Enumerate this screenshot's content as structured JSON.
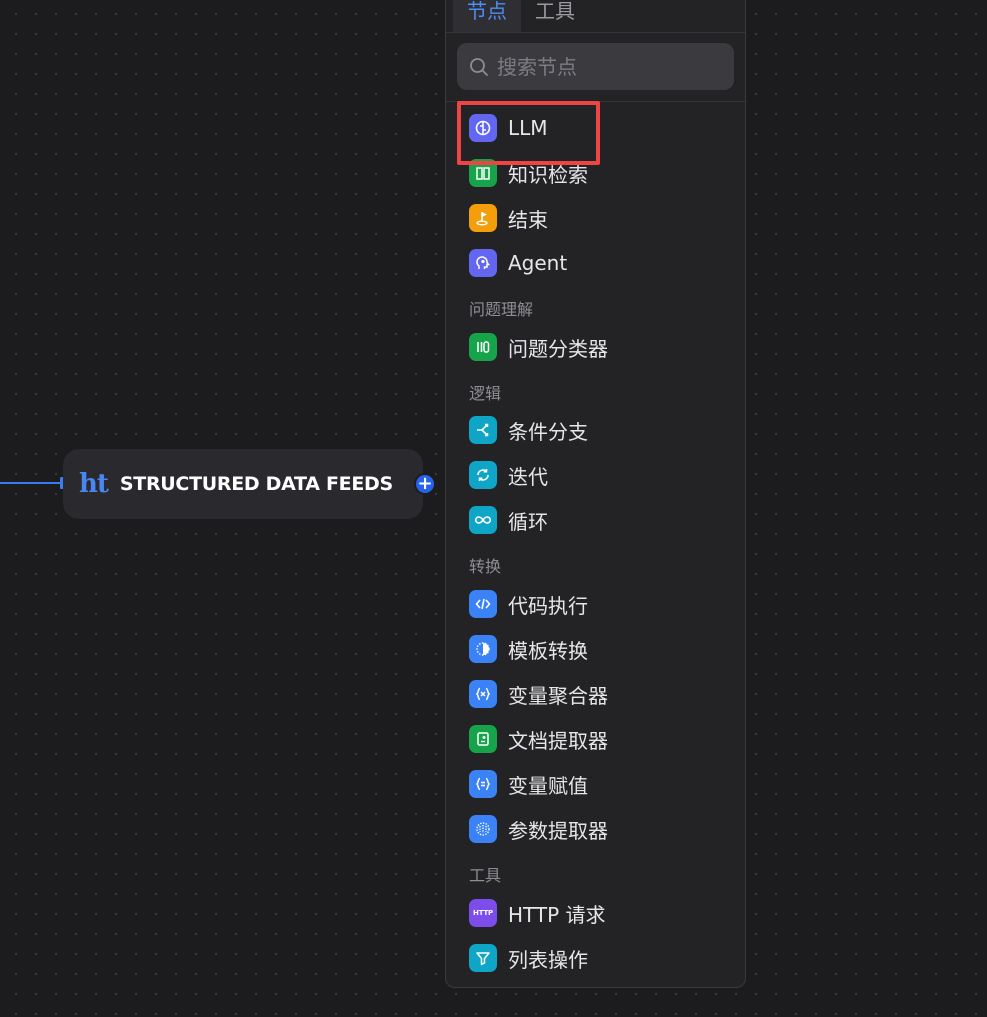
{
  "node": {
    "logo_text": "ht",
    "title": "STRUCTURED DATA FEEDS",
    "add_symbol": "+"
  },
  "panel": {
    "tabs": [
      {
        "label": "节点",
        "active": true
      },
      {
        "label": "工具",
        "active": false
      }
    ],
    "search": {
      "placeholder": "搜索节点",
      "value": ""
    },
    "items": [
      {
        "label": "LLM",
        "icon": "brain-icon",
        "color": "#6366f1"
      },
      {
        "label": "知识检索",
        "icon": "book-icon",
        "color": "#16a34a"
      },
      {
        "label": "结束",
        "icon": "flag-icon",
        "color": "#f59e0b"
      },
      {
        "label": "Agent",
        "icon": "agent-head-icon",
        "color": "#6366f1"
      },
      {
        "label": "问题分类器",
        "icon": "classifier-icon",
        "color": "#16a34a"
      },
      {
        "label": "条件分支",
        "icon": "branch-icon",
        "color": "#0ea5c6"
      },
      {
        "label": "迭代",
        "icon": "iteration-icon",
        "color": "#0ea5c6"
      },
      {
        "label": "循环",
        "icon": "infinity-icon",
        "color": "#0ea5c6"
      },
      {
        "label": "代码执行",
        "icon": "code-icon",
        "color": "#3b82f6"
      },
      {
        "label": "模板转换",
        "icon": "template-icon",
        "color": "#3b82f6"
      },
      {
        "label": "变量聚合器",
        "icon": "variable-aggregator-icon",
        "color": "#3b82f6"
      },
      {
        "label": "文档提取器",
        "icon": "document-icon",
        "color": "#16a34a"
      },
      {
        "label": "变量赋值",
        "icon": "assign-icon",
        "color": "#3b82f6"
      },
      {
        "label": "参数提取器",
        "icon": "parameter-icon",
        "color": "#3b82f6"
      },
      {
        "label": "HTTP 请求",
        "icon": "http-icon",
        "color": "#7c4dea"
      },
      {
        "label": "列表操作",
        "icon": "filter-icon",
        "color": "#0ea5c6"
      }
    ],
    "sections": [
      {
        "label": "问题理解"
      },
      {
        "label": "逻辑"
      },
      {
        "label": "转换"
      },
      {
        "label": "工具"
      }
    ],
    "http_icon_text": "HTTP"
  },
  "colors": {
    "accent": "#4f8ef7",
    "highlight": "#ef4444",
    "edge": "#3b7bf0"
  }
}
